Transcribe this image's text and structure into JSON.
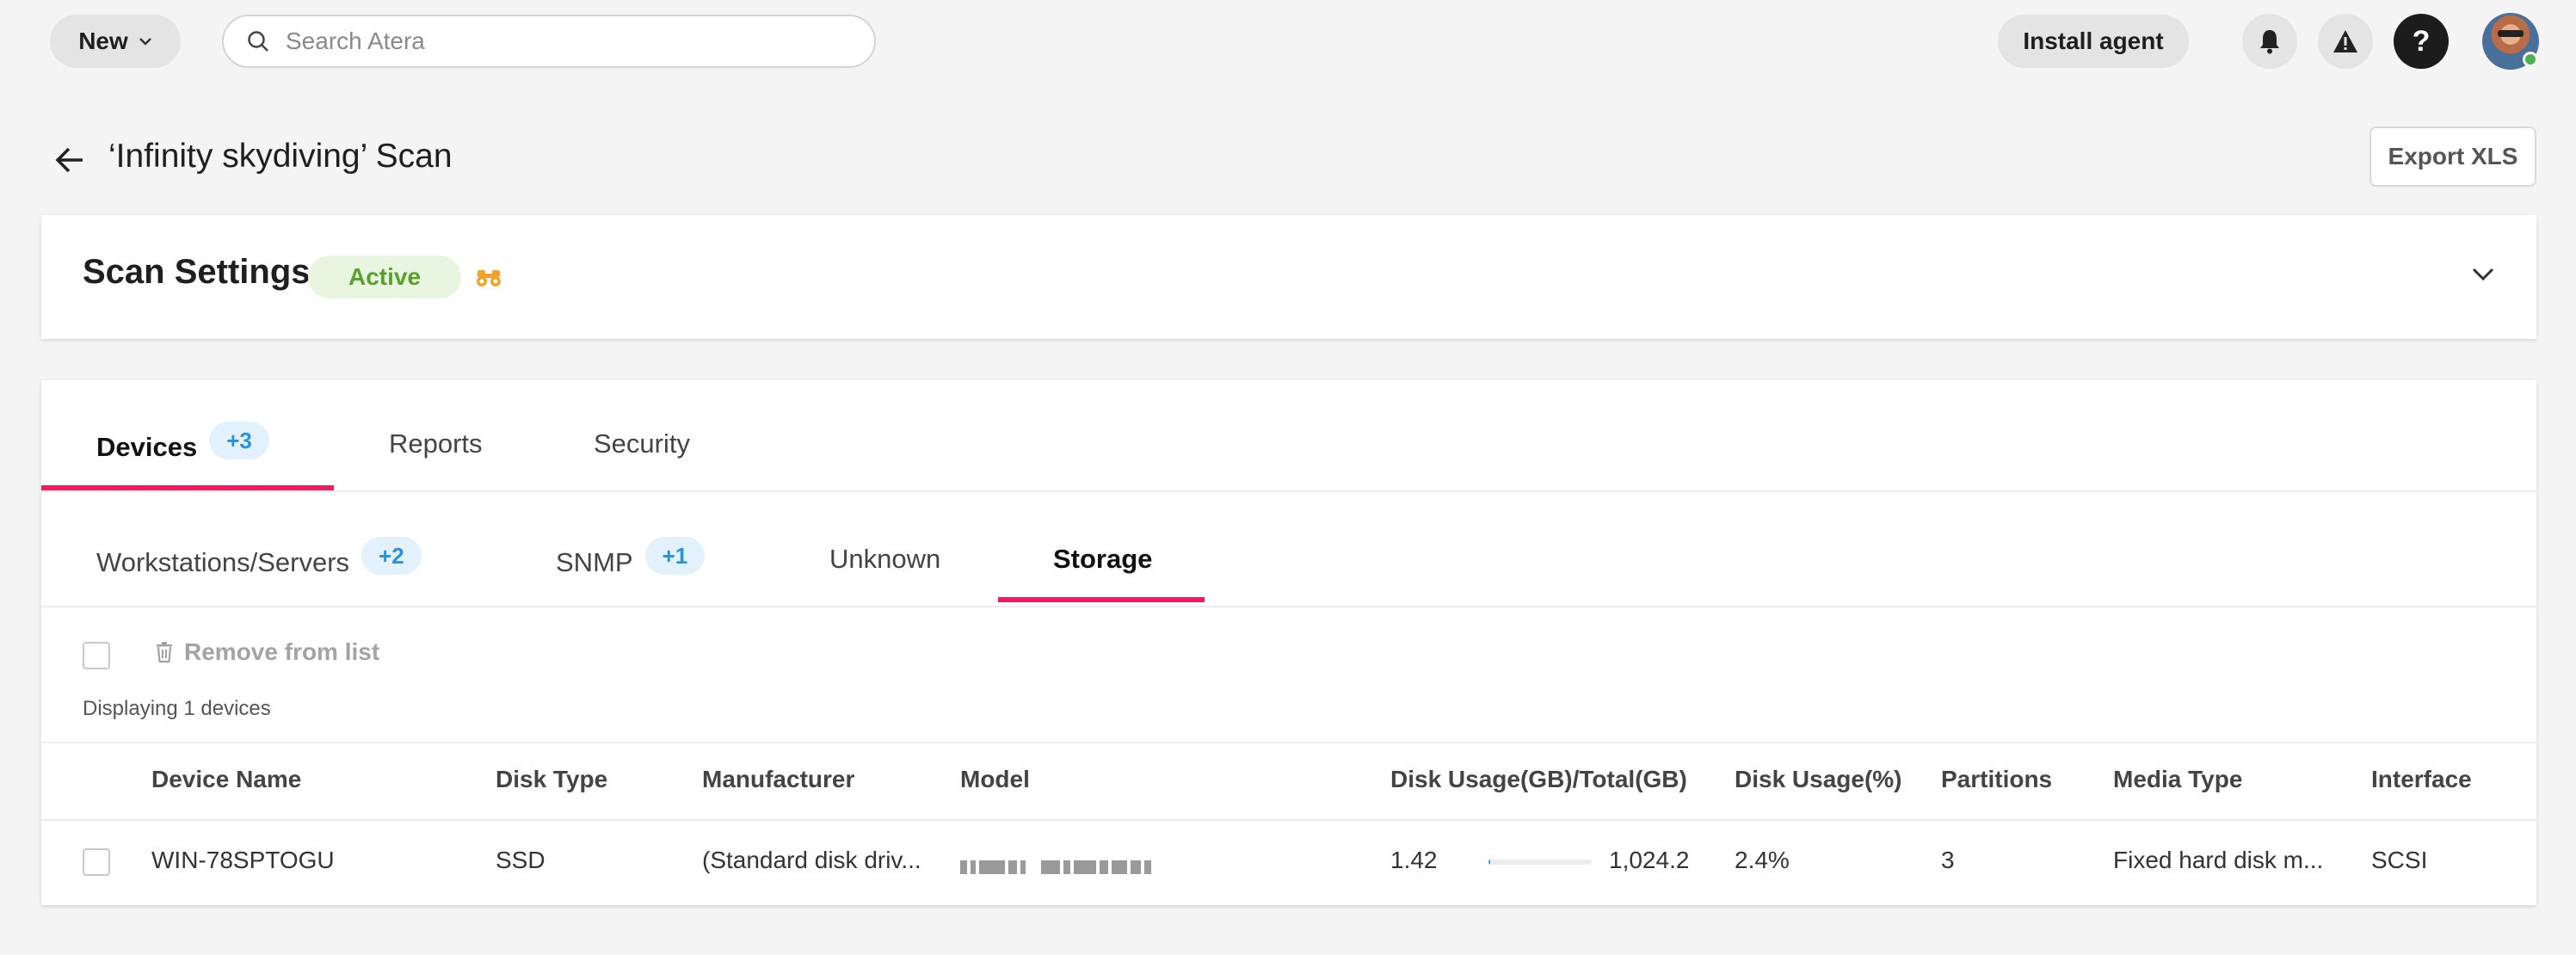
{
  "topbar": {
    "new_label": "New",
    "search_placeholder": "Search Atera",
    "install_label": "Install agent",
    "help_label": "?"
  },
  "page": {
    "title": "‘Infinity skydiving’ Scan",
    "export_label": "Export XLS"
  },
  "settings": {
    "title": "Scan Settings",
    "status": "Active"
  },
  "tabs": [
    {
      "label": "Devices",
      "badge": "+3"
    },
    {
      "label": "Reports"
    },
    {
      "label": "Security"
    }
  ],
  "subtabs": [
    {
      "label": "Workstations/Servers",
      "badge": "+2"
    },
    {
      "label": "SNMP",
      "badge": "+1"
    },
    {
      "label": "Unknown"
    },
    {
      "label": "Storage"
    }
  ],
  "toolbar": {
    "remove_label": "Remove from list",
    "displaying": "Displaying 1 devices"
  },
  "table": {
    "columns": [
      "Device Name",
      "Disk Type",
      "Manufacturer",
      "Model",
      "Disk Usage(GB)/Total(GB)",
      "Disk Usage(%)",
      "Partitions",
      "Media Type",
      "Interface"
    ],
    "rows": [
      {
        "device_name": "WIN-78SPTOGU",
        "disk_type": "SSD",
        "manufacturer": "(Standard disk driv...",
        "usage_gb": "1.42",
        "usage_fraction": 0.014,
        "total_gb": "1,024.2",
        "usage_pct": "2.4%",
        "partitions": "3",
        "media_type": "Fixed hard disk m...",
        "interface": "SCSI"
      }
    ]
  },
  "colors": {
    "accent": "#e91e63",
    "badge_blue": "#2a92d6",
    "active_green": "#5aa02c"
  }
}
